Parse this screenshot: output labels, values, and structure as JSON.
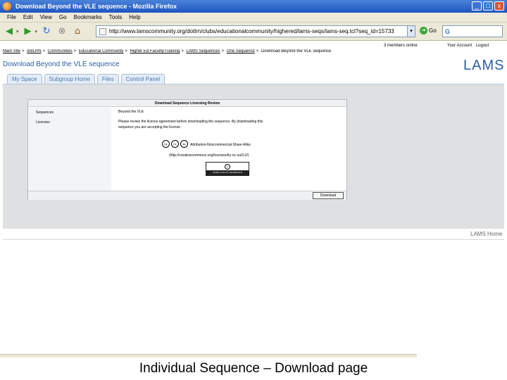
{
  "window": {
    "title": "Download Beyond the VLE sequence - Mozilla Firefox",
    "min": "_",
    "max": "□",
    "close": "x"
  },
  "menu": [
    "File",
    "Edit",
    "View",
    "Go",
    "Bookmarks",
    "Tools",
    "Help"
  ],
  "nav": {
    "url": "http://www.lamscommunity.org/dotlrn/clubs/educationalcommunity/highered/lams-seqs/lams-seq.tcl?seq_id=15733",
    "go_label": "Go"
  },
  "header": {
    "members_online": "3 members online",
    "your_account": "Your Account",
    "logout": "Logout",
    "breadcrumbs": [
      "Main Site",
      "dotLRN",
      "Communities",
      "Educational Community",
      "Higher Ed Faculty/Training",
      "LAMS Sequences",
      "One Sequence",
      "Download Beyond the VLE sequence"
    ],
    "page_title": "Download Beyond the VLE sequence",
    "logo": "LAMS"
  },
  "tabs": [
    "My Space",
    "Subgroup Home",
    "Files",
    "Control Panel"
  ],
  "review": {
    "title": "Download Sequence Licensing Review",
    "sequence_label": "Sequences",
    "sequence_value": "Beyond the VLE",
    "license_label": "Licenses",
    "license_text_1": "Please review the license agreement before downloading the sequence. By downloading this",
    "license_text_2": "sequence you are accepting the license.",
    "license_name": "Attribution-Noncommercial-Share Alike",
    "license_url": "(http://creativecommons.org/licenses/by-nc-sa/3.0/)",
    "cc_icons": [
      "by",
      "nc",
      "sa"
    ],
    "badge_top": "cc",
    "badge_bottom": "SOME RIGHTS RESERVED",
    "download_button": "Download"
  },
  "footer": {
    "lams_home": "LAMS Home"
  },
  "caption": "Individual Sequence – Download page"
}
